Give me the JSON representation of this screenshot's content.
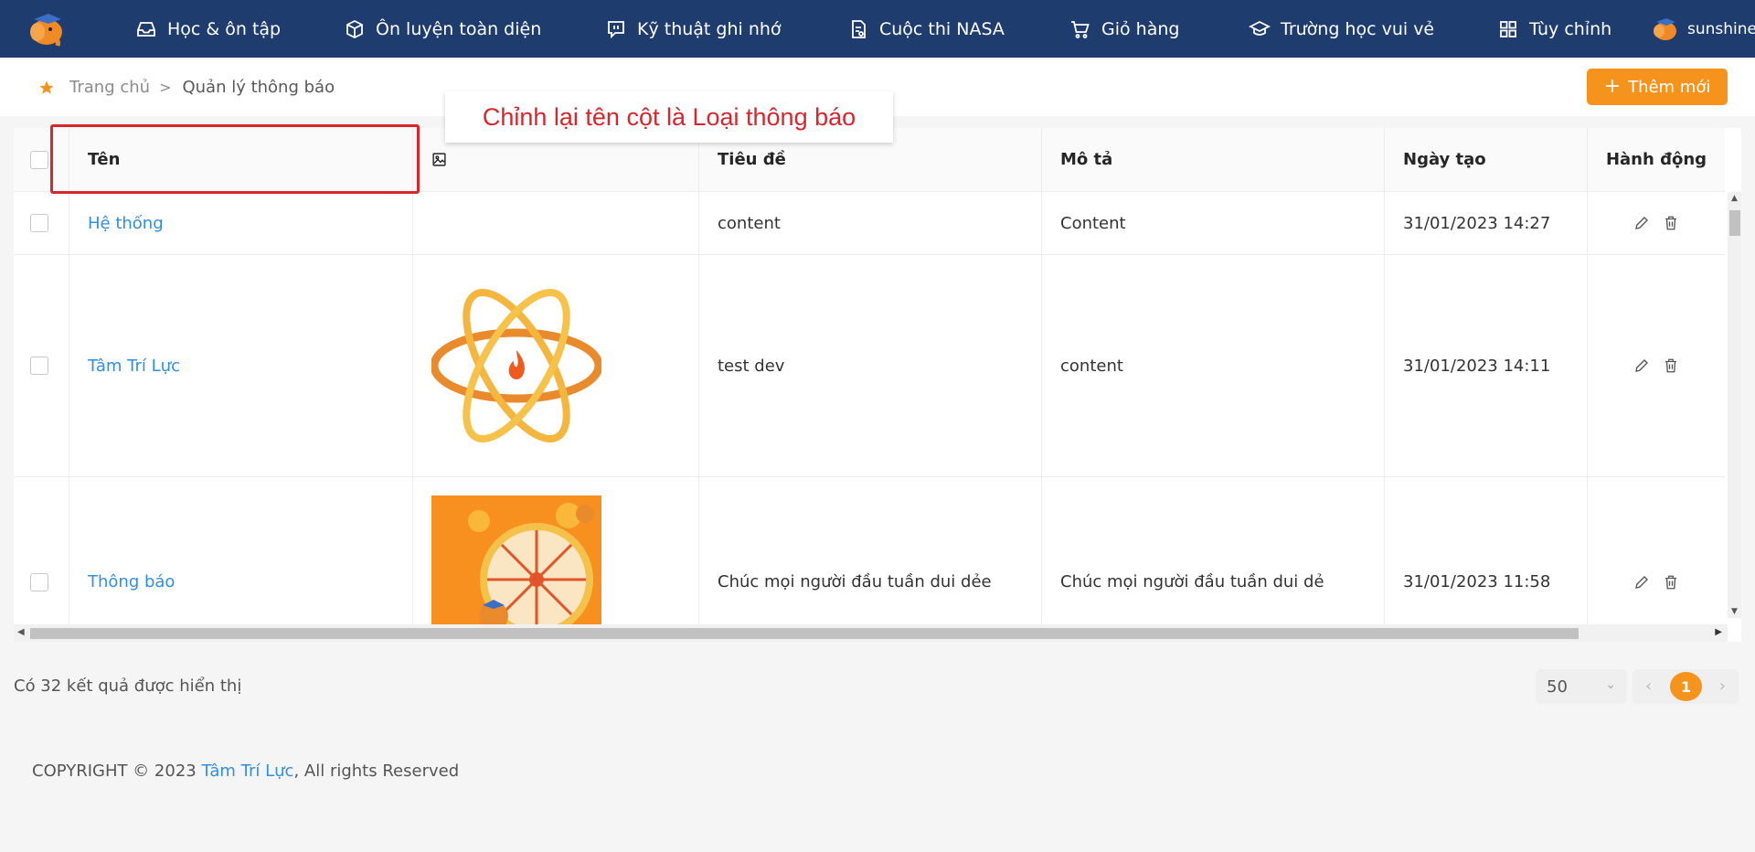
{
  "nav": {
    "items": [
      {
        "label": "Học & ôn tập",
        "icon": "inbox-icon"
      },
      {
        "label": "Ôn luyện toàn diện",
        "icon": "box-icon"
      },
      {
        "label": "Kỹ thuật ghi nhớ",
        "icon": "chat-icon"
      },
      {
        "label": "Cuộc thi NASA",
        "icon": "document-icon"
      },
      {
        "label": "Giỏ hàng",
        "icon": "cart-icon"
      },
      {
        "label": "Trường học vui vẻ",
        "icon": "graduation-cap-icon"
      },
      {
        "label": "Tùy chỉnh",
        "icon": "grid-icon"
      }
    ],
    "user": "sunshine"
  },
  "breadcrumb": {
    "home": "Trang chủ",
    "separator": ">",
    "current": "Quản lý thông báo"
  },
  "add_button": {
    "label": "Thêm mới"
  },
  "table": {
    "headers": [
      "Tên",
      "",
      "Tiêu đề",
      "Mô tả",
      "Ngày tạo",
      "Hành động"
    ],
    "rows": [
      {
        "name": "Hệ thống",
        "title": "content",
        "description": "Content",
        "created": "31/01/2023 14:27"
      },
      {
        "name": "Tâm Trí Lực",
        "title": "test dev",
        "description": "content",
        "created": "31/01/2023 14:11"
      },
      {
        "name": "Thông báo",
        "title": "Chúc mọi người đầu tuần dui dẻe",
        "description": "Chúc mọi người đầu tuần dui dẻ",
        "created": "31/01/2023 11:58"
      }
    ]
  },
  "result_text": "Có 32 kết quả được hiển thị",
  "pagination": {
    "page_size": "50",
    "current_page": "1"
  },
  "footer": {
    "prefix": "COPYRIGHT © 2023 ",
    "brand": "Tâm Trí Lực",
    "suffix": ", All rights Reserved"
  },
  "annotation": {
    "text": "Chỉnh lại tên cột là Loại thông báo"
  },
  "colors": {
    "navbar": "#1f3c6e",
    "accent": "#f6931d",
    "link": "#2f8fe8",
    "annotation": "#d8262c"
  }
}
